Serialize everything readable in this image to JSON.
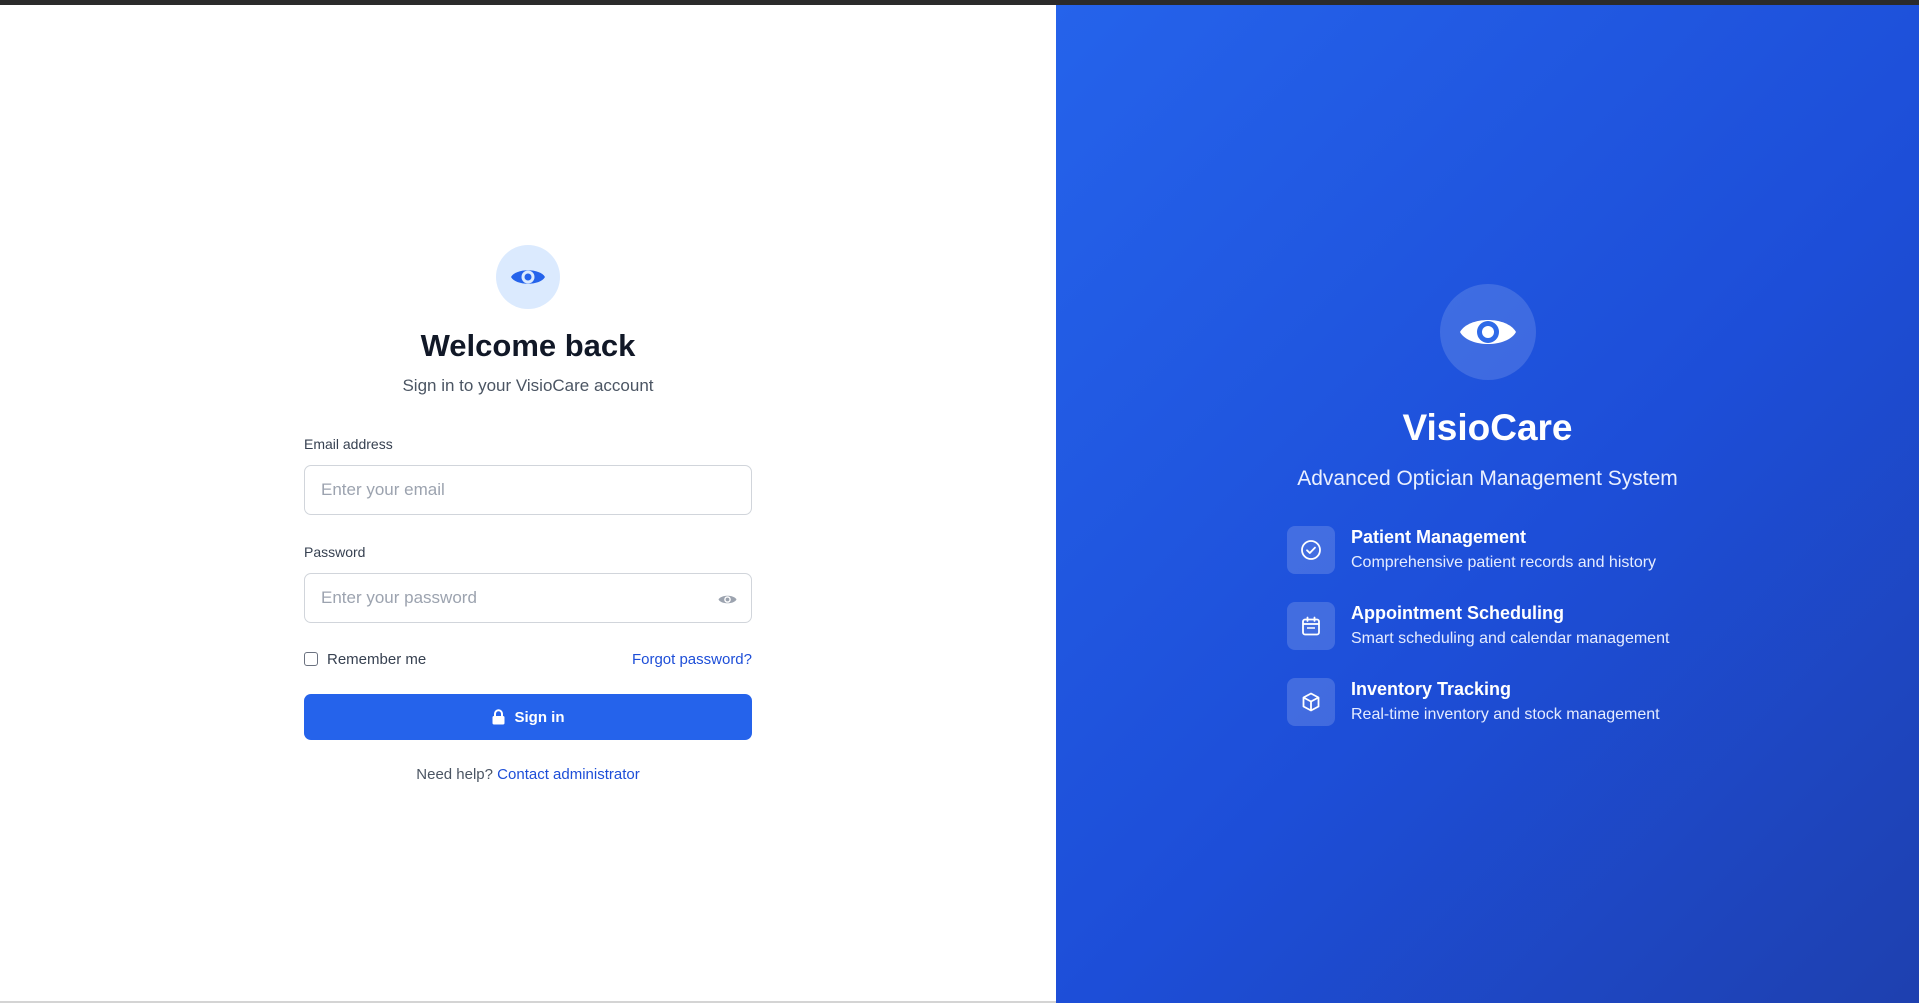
{
  "login": {
    "title": "Welcome back",
    "subtitle": "Sign in to your VisioCare account",
    "email_label": "Email address",
    "email_placeholder": "Enter your email",
    "email_value": "",
    "password_label": "Password",
    "password_placeholder": "Enter your password",
    "password_value": "",
    "remember_label": "Remember me",
    "remember_checked": false,
    "forgot_label": "Forgot password?",
    "signin_label": "Sign in",
    "help_text": "Need help?",
    "help_link": "Contact administrator"
  },
  "brand": {
    "name": "VisioCare",
    "tagline": "Advanced Optician Management System",
    "features": [
      {
        "icon": "check-circle-icon",
        "title": "Patient Management",
        "description": "Comprehensive patient records and history"
      },
      {
        "icon": "calendar-icon",
        "title": "Appointment Scheduling",
        "description": "Smart scheduling and calendar management"
      },
      {
        "icon": "box-icon",
        "title": "Inventory Tracking",
        "description": "Real-time inventory and stock management"
      }
    ]
  },
  "colors": {
    "primary": "#2563eb",
    "primary_dark": "#1e40af",
    "logo_bg": "#dbeafe",
    "link": "#1d4ed8",
    "heading": "#111827"
  }
}
